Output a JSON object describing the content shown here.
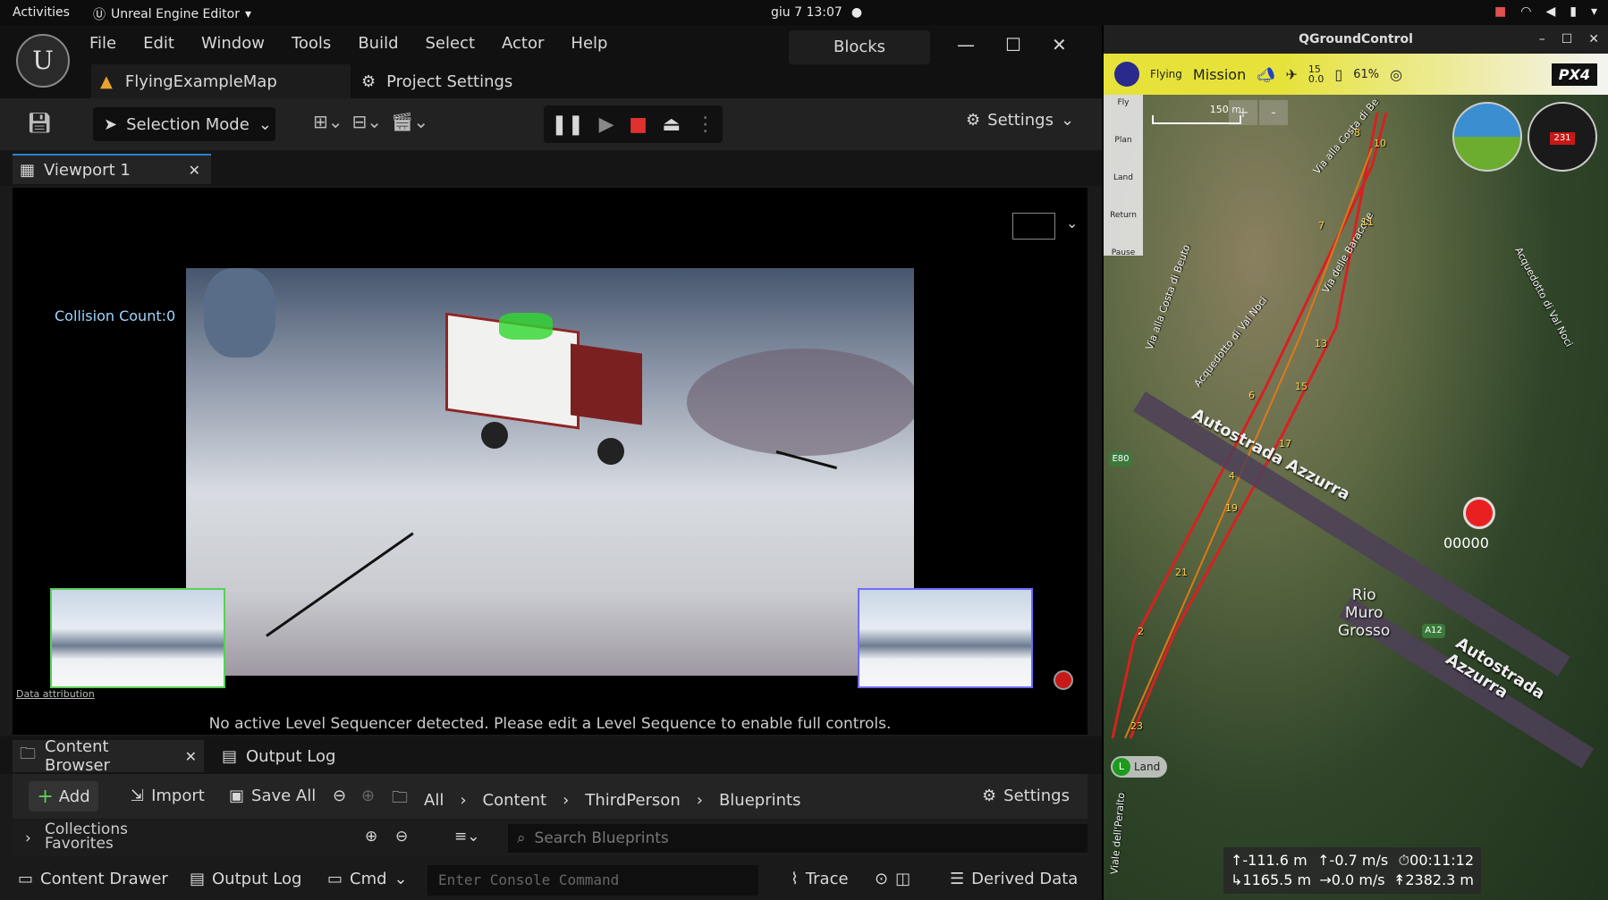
{
  "system_bar": {
    "activities": "Activities",
    "app_name": "Unreal Engine Editor",
    "clock": "giu 7  13:07"
  },
  "unreal": {
    "menus": [
      "File",
      "Edit",
      "Window",
      "Tools",
      "Build",
      "Select",
      "Actor",
      "Help"
    ],
    "project_name": "Blocks",
    "map_tab": "FlyingExampleMap",
    "settings_tab": "Project Settings",
    "selection_mode": "Selection Mode",
    "settings_label": "Settings",
    "viewport_tab": "Viewport 1",
    "collision_count": "Collision Count:0",
    "data_attribution": "Data attribution",
    "sequencer_message": "No active Level Sequencer detected. Please edit a Level Sequence to enable full controls.",
    "bottom_tabs": {
      "content_browser": "Content Browser",
      "output_log": "Output Log"
    },
    "content_browser": {
      "add": "Add",
      "import": "Import",
      "save_all": "Save All",
      "breadcrumb": [
        "All",
        "Content",
        "ThirdPerson",
        "Blueprints"
      ],
      "settings": "Settings",
      "collections": "Collections",
      "favorites": "Favorites",
      "search_placeholder": "Search Blueprints"
    },
    "status_bar": {
      "content_drawer": "Content Drawer",
      "output_log": "Output Log",
      "cmd": "Cmd",
      "console_placeholder": "Enter Console Command",
      "trace": "Trace",
      "derived_data": "Derived Data"
    }
  },
  "qgc": {
    "title": "QGroundControl",
    "flight_mode": "Flying",
    "mission": "Mission",
    "gps_sats": "15",
    "gps_hdop": "0.0",
    "battery": "61%",
    "brand": "PX4",
    "tools": [
      "Fly",
      "Plan",
      "Land",
      "Return",
      "Pause"
    ],
    "scale": "150 m",
    "heading": "231",
    "record_counter": "00000",
    "land_label": "Land",
    "land_letter": "L",
    "map_labels": {
      "autostrada1": "Autostrada Azzurra",
      "autostrada2": "Autostrada Azzurra",
      "rio_line1": "Rio",
      "rio_line2": "Muro",
      "rio_line3": "Grosso",
      "a12": "A12",
      "e80": "E80",
      "via_costa": "Via alla Costa di Be",
      "acquedotto": "Acquedotto di Val Noci",
      "acquedotto2": "Acquedotto di Val Noci",
      "via_baracche": "Via delle Baracche",
      "via_beuto": "Via alla Costa di Beuto",
      "viale_peralto": "Viale dell'Peralto"
    },
    "waypoints": [
      "2",
      "4",
      "6",
      "7",
      "8",
      "10",
      "11",
      "13",
      "15",
      "17",
      "19",
      "21",
      "23"
    ],
    "telemetry": {
      "alt_rel": "-111.6 m",
      "vspeed": "-0.7 m/s",
      "flight_time": "00:11:12",
      "distance": "1165.5 m",
      "hspeed": "0.0 m/s",
      "alt_amsl": "2382.3 m"
    }
  }
}
